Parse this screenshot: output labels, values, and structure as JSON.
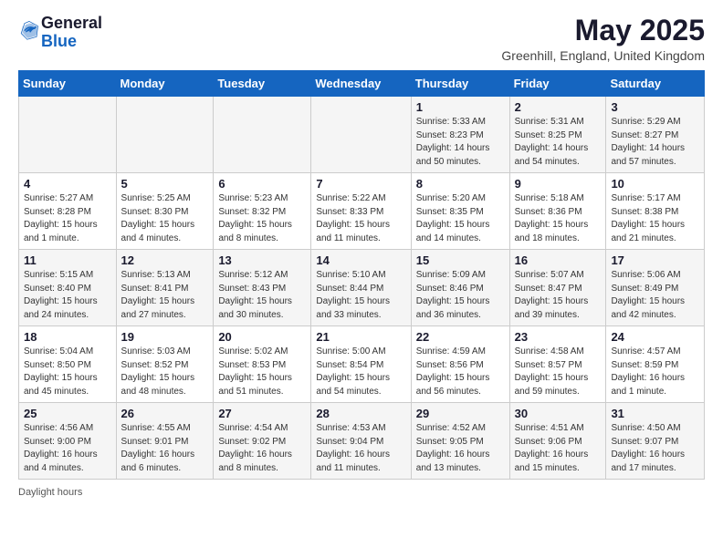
{
  "header": {
    "logo_general": "General",
    "logo_blue": "Blue",
    "month_title": "May 2025",
    "subtitle": "Greenhill, England, United Kingdom"
  },
  "footer": {
    "daylight_label": "Daylight hours"
  },
  "weekdays": [
    "Sunday",
    "Monday",
    "Tuesday",
    "Wednesday",
    "Thursday",
    "Friday",
    "Saturday"
  ],
  "weeks": [
    [
      {
        "day": "",
        "info": ""
      },
      {
        "day": "",
        "info": ""
      },
      {
        "day": "",
        "info": ""
      },
      {
        "day": "",
        "info": ""
      },
      {
        "day": "1",
        "info": "Sunrise: 5:33 AM\nSunset: 8:23 PM\nDaylight: 14 hours\nand 50 minutes."
      },
      {
        "day": "2",
        "info": "Sunrise: 5:31 AM\nSunset: 8:25 PM\nDaylight: 14 hours\nand 54 minutes."
      },
      {
        "day": "3",
        "info": "Sunrise: 5:29 AM\nSunset: 8:27 PM\nDaylight: 14 hours\nand 57 minutes."
      }
    ],
    [
      {
        "day": "4",
        "info": "Sunrise: 5:27 AM\nSunset: 8:28 PM\nDaylight: 15 hours\nand 1 minute."
      },
      {
        "day": "5",
        "info": "Sunrise: 5:25 AM\nSunset: 8:30 PM\nDaylight: 15 hours\nand 4 minutes."
      },
      {
        "day": "6",
        "info": "Sunrise: 5:23 AM\nSunset: 8:32 PM\nDaylight: 15 hours\nand 8 minutes."
      },
      {
        "day": "7",
        "info": "Sunrise: 5:22 AM\nSunset: 8:33 PM\nDaylight: 15 hours\nand 11 minutes."
      },
      {
        "day": "8",
        "info": "Sunrise: 5:20 AM\nSunset: 8:35 PM\nDaylight: 15 hours\nand 14 minutes."
      },
      {
        "day": "9",
        "info": "Sunrise: 5:18 AM\nSunset: 8:36 PM\nDaylight: 15 hours\nand 18 minutes."
      },
      {
        "day": "10",
        "info": "Sunrise: 5:17 AM\nSunset: 8:38 PM\nDaylight: 15 hours\nand 21 minutes."
      }
    ],
    [
      {
        "day": "11",
        "info": "Sunrise: 5:15 AM\nSunset: 8:40 PM\nDaylight: 15 hours\nand 24 minutes."
      },
      {
        "day": "12",
        "info": "Sunrise: 5:13 AM\nSunset: 8:41 PM\nDaylight: 15 hours\nand 27 minutes."
      },
      {
        "day": "13",
        "info": "Sunrise: 5:12 AM\nSunset: 8:43 PM\nDaylight: 15 hours\nand 30 minutes."
      },
      {
        "day": "14",
        "info": "Sunrise: 5:10 AM\nSunset: 8:44 PM\nDaylight: 15 hours\nand 33 minutes."
      },
      {
        "day": "15",
        "info": "Sunrise: 5:09 AM\nSunset: 8:46 PM\nDaylight: 15 hours\nand 36 minutes."
      },
      {
        "day": "16",
        "info": "Sunrise: 5:07 AM\nSunset: 8:47 PM\nDaylight: 15 hours\nand 39 minutes."
      },
      {
        "day": "17",
        "info": "Sunrise: 5:06 AM\nSunset: 8:49 PM\nDaylight: 15 hours\nand 42 minutes."
      }
    ],
    [
      {
        "day": "18",
        "info": "Sunrise: 5:04 AM\nSunset: 8:50 PM\nDaylight: 15 hours\nand 45 minutes."
      },
      {
        "day": "19",
        "info": "Sunrise: 5:03 AM\nSunset: 8:52 PM\nDaylight: 15 hours\nand 48 minutes."
      },
      {
        "day": "20",
        "info": "Sunrise: 5:02 AM\nSunset: 8:53 PM\nDaylight: 15 hours\nand 51 minutes."
      },
      {
        "day": "21",
        "info": "Sunrise: 5:00 AM\nSunset: 8:54 PM\nDaylight: 15 hours\nand 54 minutes."
      },
      {
        "day": "22",
        "info": "Sunrise: 4:59 AM\nSunset: 8:56 PM\nDaylight: 15 hours\nand 56 minutes."
      },
      {
        "day": "23",
        "info": "Sunrise: 4:58 AM\nSunset: 8:57 PM\nDaylight: 15 hours\nand 59 minutes."
      },
      {
        "day": "24",
        "info": "Sunrise: 4:57 AM\nSunset: 8:59 PM\nDaylight: 16 hours\nand 1 minute."
      }
    ],
    [
      {
        "day": "25",
        "info": "Sunrise: 4:56 AM\nSunset: 9:00 PM\nDaylight: 16 hours\nand 4 minutes."
      },
      {
        "day": "26",
        "info": "Sunrise: 4:55 AM\nSunset: 9:01 PM\nDaylight: 16 hours\nand 6 minutes."
      },
      {
        "day": "27",
        "info": "Sunrise: 4:54 AM\nSunset: 9:02 PM\nDaylight: 16 hours\nand 8 minutes."
      },
      {
        "day": "28",
        "info": "Sunrise: 4:53 AM\nSunset: 9:04 PM\nDaylight: 16 hours\nand 11 minutes."
      },
      {
        "day": "29",
        "info": "Sunrise: 4:52 AM\nSunset: 9:05 PM\nDaylight: 16 hours\nand 13 minutes."
      },
      {
        "day": "30",
        "info": "Sunrise: 4:51 AM\nSunset: 9:06 PM\nDaylight: 16 hours\nand 15 minutes."
      },
      {
        "day": "31",
        "info": "Sunrise: 4:50 AM\nSunset: 9:07 PM\nDaylight: 16 hours\nand 17 minutes."
      }
    ]
  ]
}
